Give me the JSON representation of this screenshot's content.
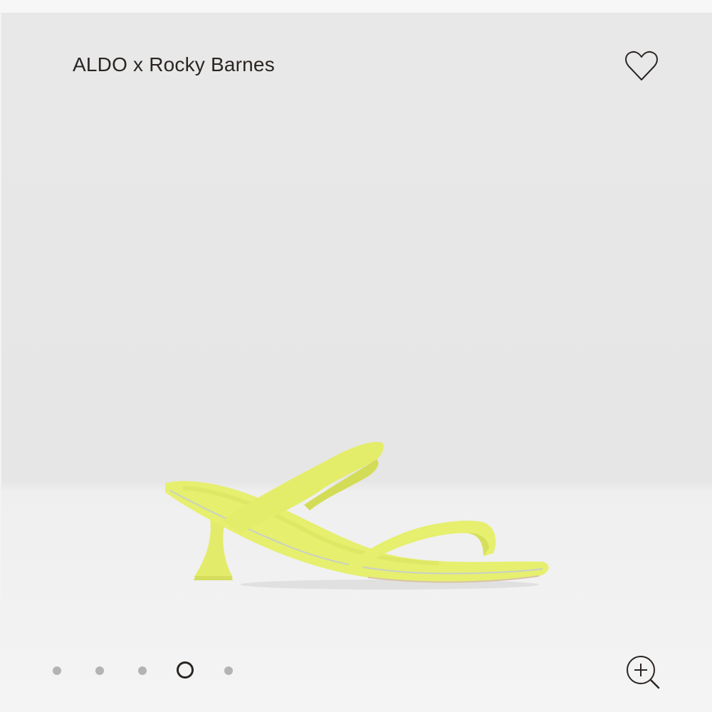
{
  "product": {
    "brand_title": "ALDO x Rocky Barnes",
    "image_alt": "Yellow two-strap kitten heel sandal"
  },
  "actions": {
    "wishlist_icon": "heart-outline-icon",
    "zoom_icon": "zoom-in-icon"
  },
  "gallery": {
    "total_images": 5,
    "active_index": 3
  },
  "colors": {
    "background": "#e8e8e8",
    "text": "#2a2522",
    "sandal": "#e6ef6e",
    "dot_inactive": "#b3b3b3"
  }
}
